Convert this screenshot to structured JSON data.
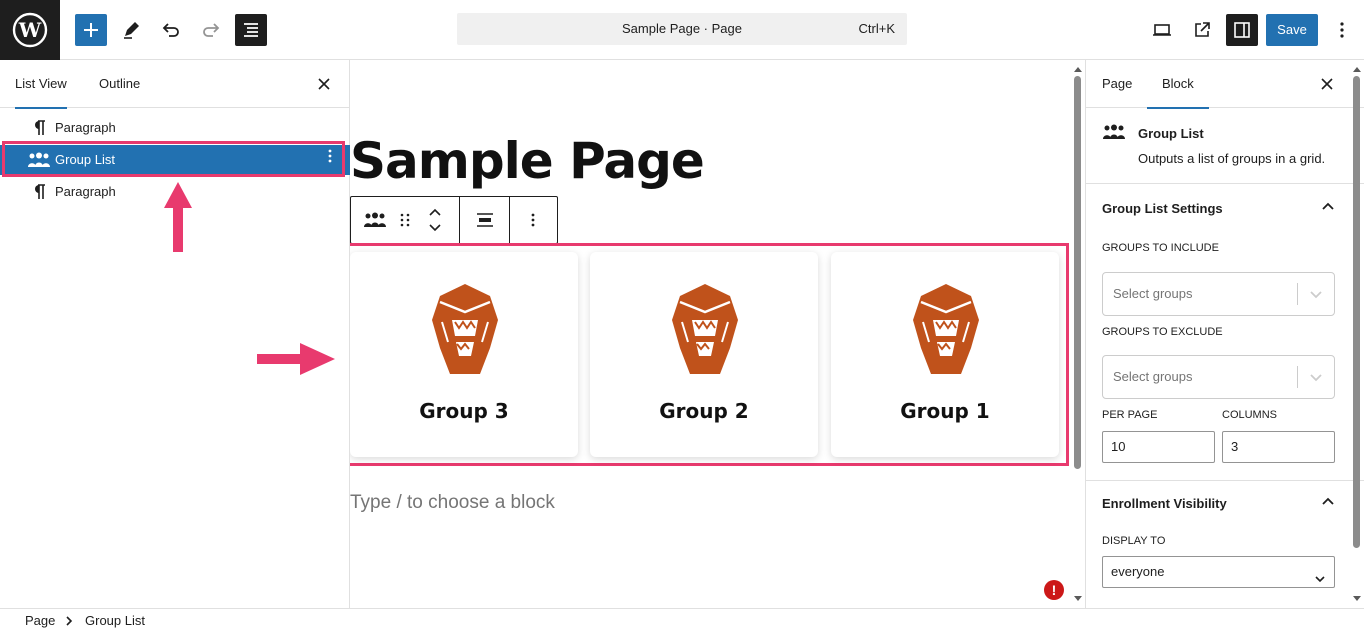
{
  "topbar": {
    "command_title": "Sample Page · Page",
    "shortcut": "Ctrl+K",
    "save_label": "Save"
  },
  "left_panel": {
    "tabs": [
      {
        "label": "List View",
        "active": true
      },
      {
        "label": "Outline",
        "active": false
      }
    ],
    "items": [
      {
        "label": "Paragraph",
        "icon": "paragraph-icon",
        "selected": false
      },
      {
        "label": "Group List",
        "icon": "group-list-icon",
        "selected": true
      },
      {
        "label": "Paragraph",
        "icon": "paragraph-icon",
        "selected": false
      }
    ]
  },
  "canvas": {
    "page_title": "Sample Page",
    "cards": [
      {
        "name": "Group 3"
      },
      {
        "name": "Group 2"
      },
      {
        "name": "Group 1"
      }
    ],
    "placeholder": "Type / to choose a block"
  },
  "right_panel": {
    "tabs": [
      {
        "label": "Page",
        "active": false
      },
      {
        "label": "Block",
        "active": true
      }
    ],
    "block_card": {
      "title": "Group List",
      "description": "Outputs a list of groups in a grid."
    },
    "group_list_settings": {
      "heading": "Group List Settings",
      "include_label": "GROUPS TO INCLUDE",
      "include_placeholder": "Select groups",
      "exclude_label": "GROUPS TO EXCLUDE",
      "exclude_placeholder": "Select groups",
      "per_page_label": "PER PAGE",
      "per_page_value": "10",
      "columns_label": "COLUMNS",
      "columns_value": "3"
    },
    "enrollment": {
      "heading": "Enrollment Visibility",
      "display_label": "DISPLAY TO",
      "display_value": "everyone"
    }
  },
  "footer": {
    "breadcrumbs": [
      "Page",
      "Group List"
    ]
  },
  "colors": {
    "accent": "#2271b1",
    "highlight": "#e83a6e",
    "logo_orange": "#c0521b"
  }
}
